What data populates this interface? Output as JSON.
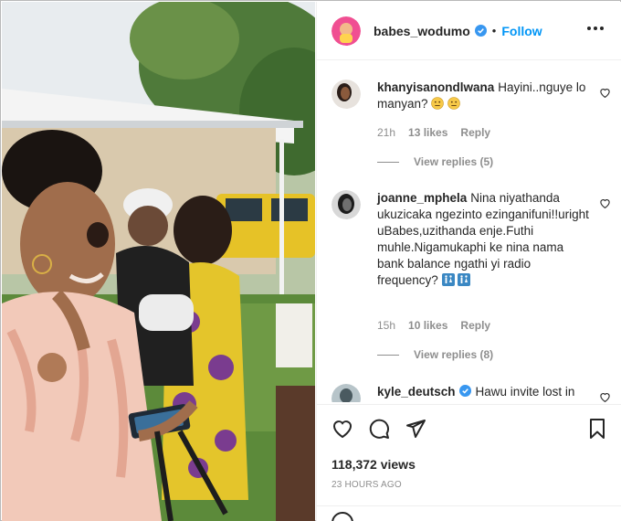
{
  "post": {
    "author": "babes_wodumo",
    "follow_label": "Follow",
    "separator": "•"
  },
  "comments": [
    {
      "username": "khanyisanondlwana",
      "text": "Hayini..nguye lo manyan?",
      "emoji": [
        "neutral-face-emoji",
        "neutral-face-emoji"
      ],
      "age": "21h",
      "likes": "13 likes",
      "reply": "Reply",
      "view_replies": "View replies (5)"
    },
    {
      "username": "joanne_mphela",
      "text": "Nina niyathanda ukuzicaka ngezinto ezinganifuni!!uright uBabes,uzithanda enje.Futhi muhle.Nigamukaphi ke nina nama bank balance ngathi yi radio frequency?",
      "emoji": [
        "restroom-emoji",
        "restroom-emoji"
      ],
      "age": "15h",
      "likes": "10 likes",
      "reply": "Reply",
      "view_replies": "View replies (8)"
    },
    {
      "username": "kyle_deutsch",
      "text": "Hawu invite lost in",
      "verified": true
    }
  ],
  "stats": {
    "views": "118,372 views",
    "posted": "23 HOURS AGO"
  },
  "icons": {
    "like": "heart-icon",
    "comment": "comment-icon",
    "share": "paper-plane-icon",
    "save": "bookmark-icon",
    "more": "more-options-icon",
    "emoji": "emoji-icon"
  },
  "colors": {
    "accent": "#0095f6",
    "verified": "#3897f0",
    "text": "#262626",
    "muted": "#8e8e8e"
  }
}
